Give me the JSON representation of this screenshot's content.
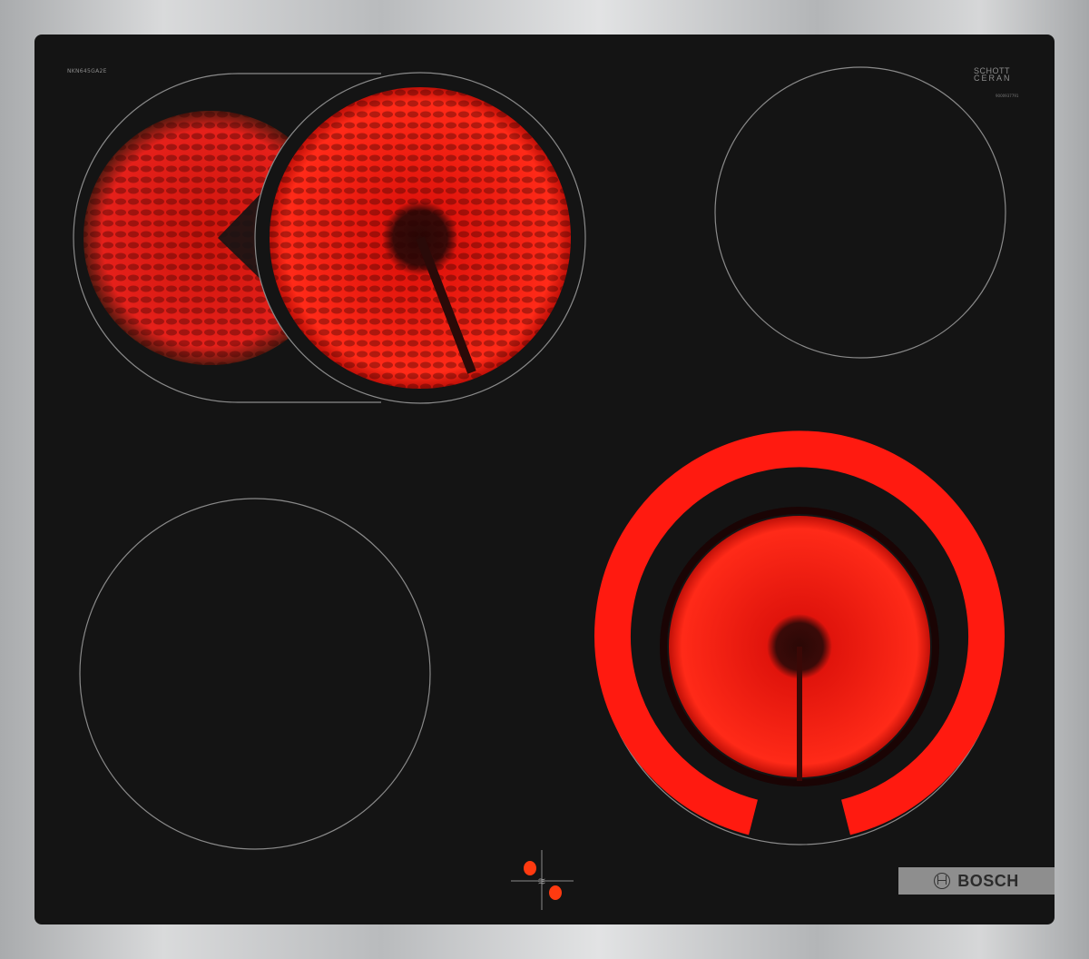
{
  "product": {
    "model": "NKN645GA2E",
    "glass_brand_line1": "SCHOTT",
    "glass_brand_line2": "CERAN",
    "serial": "9000937791",
    "brand": "BOSCH"
  },
  "zones": [
    {
      "id": "front-left-dual",
      "state": "on"
    },
    {
      "id": "rear-right",
      "state": "off"
    },
    {
      "id": "front-left",
      "state": "off"
    },
    {
      "id": "front-right-dual",
      "state": "on"
    }
  ],
  "colors": {
    "glass": "#141414",
    "heat": "#ff1a10",
    "indicator": "#ff3a10",
    "badge": "#8e8e8e"
  }
}
